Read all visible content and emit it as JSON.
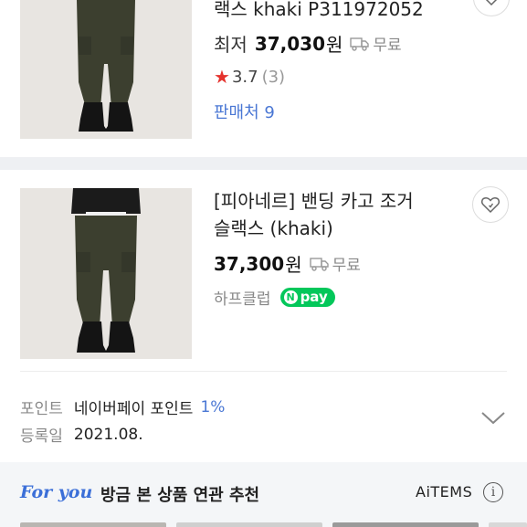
{
  "product1": {
    "title_line": "랙스 khaki P311972052",
    "price_label": "최저",
    "price": "37,030",
    "won": "원",
    "shipping": "무료",
    "rating": "3.7",
    "review_count": "(3)",
    "sellers": "판매처 9"
  },
  "product2": {
    "title_line1": "[피아네르] 밴딩 카고 조거",
    "title_line2": "슬랙스 (khaki)",
    "price": "37,300",
    "won": "원",
    "shipping": "무료",
    "mall": "하프클럽",
    "npay_label": "pay",
    "npay_n": "N"
  },
  "details": {
    "point_label": "포인트",
    "point_value": "네이버페이 포인트",
    "point_pct": "1%",
    "date_label": "등록일",
    "date_value": "2021.08."
  },
  "foryou": {
    "logo": "For you",
    "text": "방금 본 상품 연관 추천",
    "brand": "AiTEMS",
    "info": "i"
  },
  "colors": {
    "accent_blue": "#4a77d4",
    "npay_green": "#03c75a",
    "star_red": "#e5322d"
  }
}
